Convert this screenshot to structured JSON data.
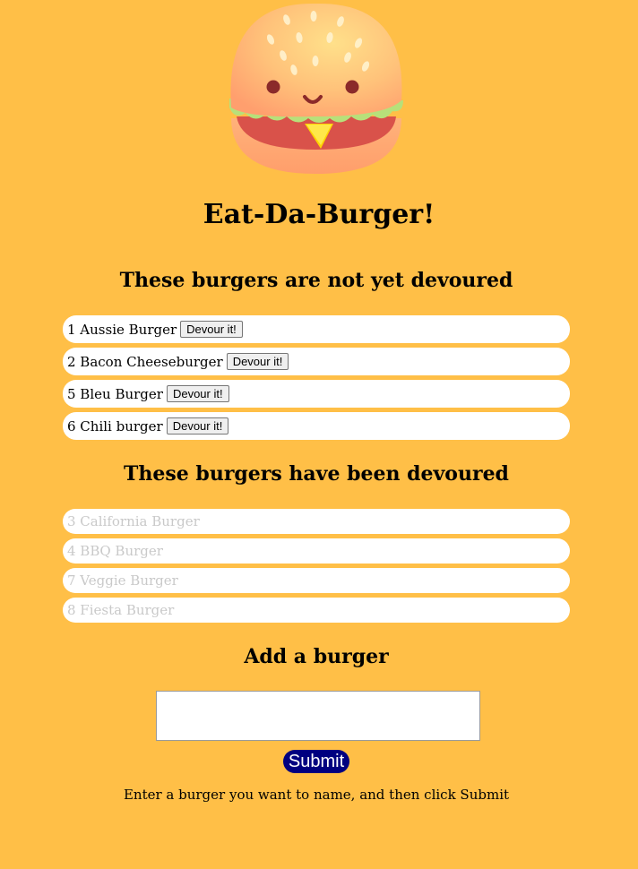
{
  "header": {
    "logo_icon": "burger-mascot-icon",
    "title": "Eat-Da-Burger!"
  },
  "undevoured": {
    "heading": "These burgers are not yet devoured",
    "button_label": "Devour it!",
    "items": [
      {
        "label": "1 Aussie Burger"
      },
      {
        "label": "2 Bacon Cheeseburger"
      },
      {
        "label": "5 Bleu Burger"
      },
      {
        "label": "6 Chili burger"
      }
    ]
  },
  "devoured": {
    "heading": "These burgers have been devoured",
    "items": [
      {
        "label": "3 California Burger"
      },
      {
        "label": "4 BBQ Burger"
      },
      {
        "label": "7 Veggie Burger"
      },
      {
        "label": "8 Fiesta Burger"
      }
    ]
  },
  "add": {
    "heading": "Add a burger",
    "input_value": "",
    "submit_label": "Submit",
    "hint": "Enter a burger you want to name, and then click Submit"
  },
  "colors": {
    "background": "#ffbf47",
    "submit": "#000080",
    "devoured_text": "#c9c9c9"
  }
}
